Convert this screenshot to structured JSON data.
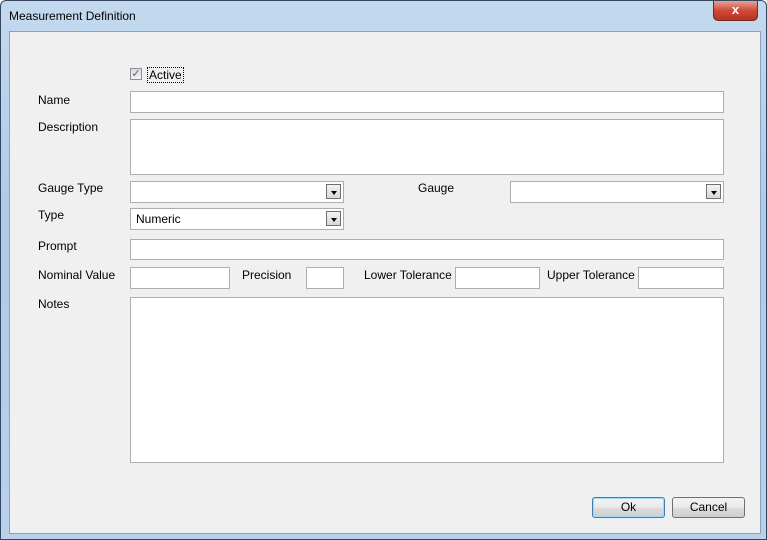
{
  "window": {
    "title": "Measurement Definition",
    "close_label": "x"
  },
  "form": {
    "active": {
      "label": "Active",
      "checked": true
    },
    "name": {
      "label": "Name",
      "value": ""
    },
    "description": {
      "label": "Description",
      "value": ""
    },
    "gauge_type": {
      "label": "Gauge Type",
      "value": ""
    },
    "gauge": {
      "label": "Gauge",
      "value": ""
    },
    "type": {
      "label": "Type",
      "value": "Numeric"
    },
    "prompt": {
      "label": "Prompt",
      "value": ""
    },
    "nominal_value": {
      "label": "Nominal Value",
      "value": ""
    },
    "precision": {
      "label": "Precision",
      "value": ""
    },
    "lower_tolerance": {
      "label": "Lower Tolerance",
      "value": ""
    },
    "upper_tolerance": {
      "label": "Upper Tolerance",
      "value": ""
    },
    "notes": {
      "label": "Notes",
      "value": ""
    }
  },
  "buttons": {
    "ok": "Ok",
    "cancel": "Cancel"
  },
  "icons": {
    "check": "✓"
  }
}
